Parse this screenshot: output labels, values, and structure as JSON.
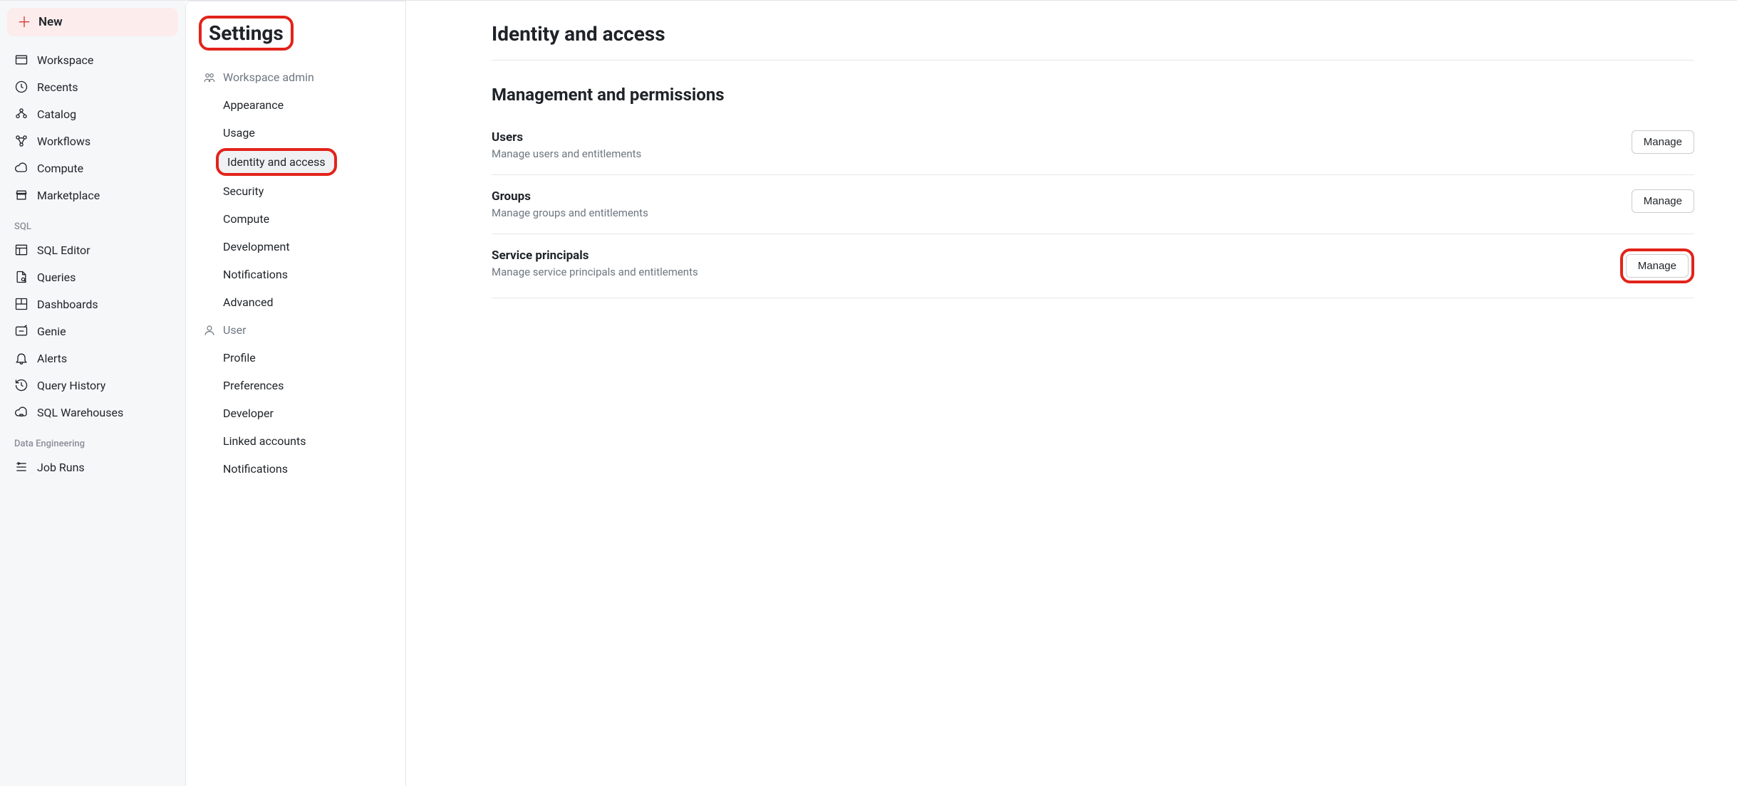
{
  "new_button_label": "New",
  "main_nav": {
    "primary": [
      {
        "id": "workspace",
        "label": "Workspace"
      },
      {
        "id": "recents",
        "label": "Recents"
      },
      {
        "id": "catalog",
        "label": "Catalog"
      },
      {
        "id": "workflows",
        "label": "Workflows"
      },
      {
        "id": "compute",
        "label": "Compute"
      },
      {
        "id": "marketplace",
        "label": "Marketplace"
      }
    ],
    "section_sql_label": "SQL",
    "sql": [
      {
        "id": "sql-editor",
        "label": "SQL Editor"
      },
      {
        "id": "queries",
        "label": "Queries"
      },
      {
        "id": "dashboards",
        "label": "Dashboards"
      },
      {
        "id": "genie",
        "label": "Genie"
      },
      {
        "id": "alerts",
        "label": "Alerts"
      },
      {
        "id": "query-history",
        "label": "Query History"
      },
      {
        "id": "sql-warehouses",
        "label": "SQL Warehouses"
      }
    ],
    "section_de_label": "Data Engineering",
    "de": [
      {
        "id": "job-runs",
        "label": "Job Runs"
      }
    ]
  },
  "settings": {
    "title": "Settings",
    "workspace_admin_label": "Workspace admin",
    "workspace_admin_items": [
      {
        "id": "appearance",
        "label": "Appearance"
      },
      {
        "id": "usage",
        "label": "Usage"
      },
      {
        "id": "identity",
        "label": "Identity and access",
        "active": true
      },
      {
        "id": "security",
        "label": "Security"
      },
      {
        "id": "compute",
        "label": "Compute"
      },
      {
        "id": "development",
        "label": "Development"
      },
      {
        "id": "notifications",
        "label": "Notifications"
      },
      {
        "id": "advanced",
        "label": "Advanced"
      }
    ],
    "user_label": "User",
    "user_items": [
      {
        "id": "profile",
        "label": "Profile"
      },
      {
        "id": "preferences",
        "label": "Preferences"
      },
      {
        "id": "developer",
        "label": "Developer"
      },
      {
        "id": "linked-accounts",
        "label": "Linked accounts"
      },
      {
        "id": "u-notifications",
        "label": "Notifications"
      }
    ]
  },
  "page": {
    "title": "Identity and access",
    "section_heading": "Management and permissions",
    "rows": [
      {
        "id": "users",
        "name": "Users",
        "desc": "Manage users and entitlements",
        "button": "Manage"
      },
      {
        "id": "groups",
        "name": "Groups",
        "desc": "Manage groups and entitlements",
        "button": "Manage"
      },
      {
        "id": "sp",
        "name": "Service principals",
        "desc": "Manage service principals and entitlements",
        "button": "Manage",
        "highlight": true
      }
    ]
  }
}
